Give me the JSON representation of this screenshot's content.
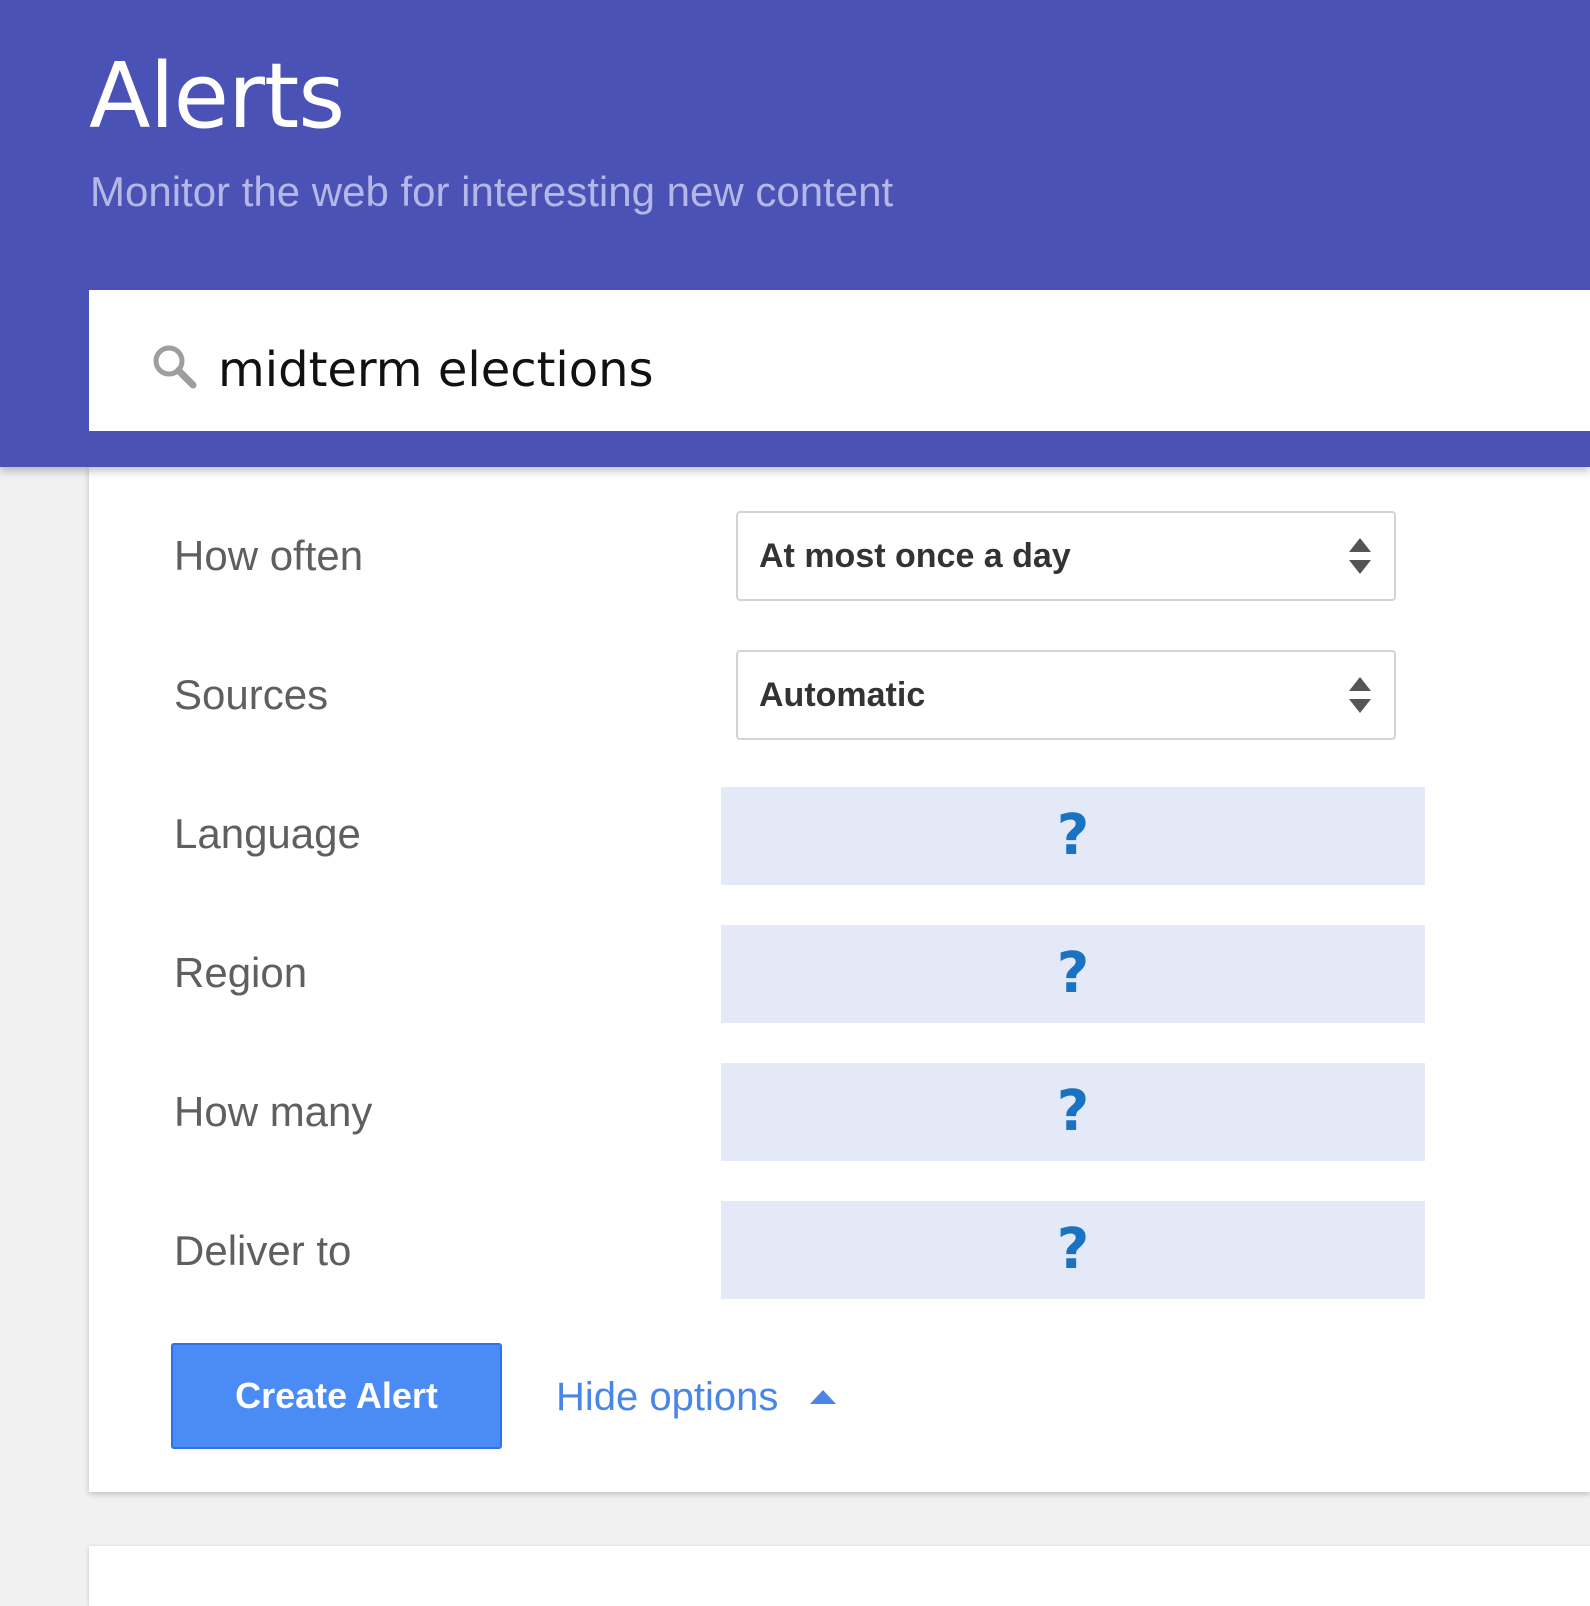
{
  "header": {
    "title": "Alerts",
    "subtitle": "Monitor the web for interesting new content"
  },
  "search": {
    "value": "midterm elections",
    "icon": "search-icon"
  },
  "options": {
    "how_often": {
      "label": "How often",
      "value": "At most once a day"
    },
    "sources": {
      "label": "Sources",
      "value": "Automatic"
    },
    "language": {
      "label": "Language",
      "value": "?"
    },
    "region": {
      "label": "Region",
      "value": "?"
    },
    "how_many": {
      "label": "How many",
      "value": "?"
    },
    "deliver_to": {
      "label": "Deliver to",
      "value": "?"
    }
  },
  "actions": {
    "create_label": "Create Alert",
    "hide_options_label": "Hide options"
  },
  "colors": {
    "header_bg": "#4a52b6",
    "subtitle": "#b5b8e6",
    "placeholder_bg": "#e3e9f7",
    "question_mark": "#1a72c2",
    "button_bg": "#4b8bf5",
    "link": "#4a86e8"
  }
}
